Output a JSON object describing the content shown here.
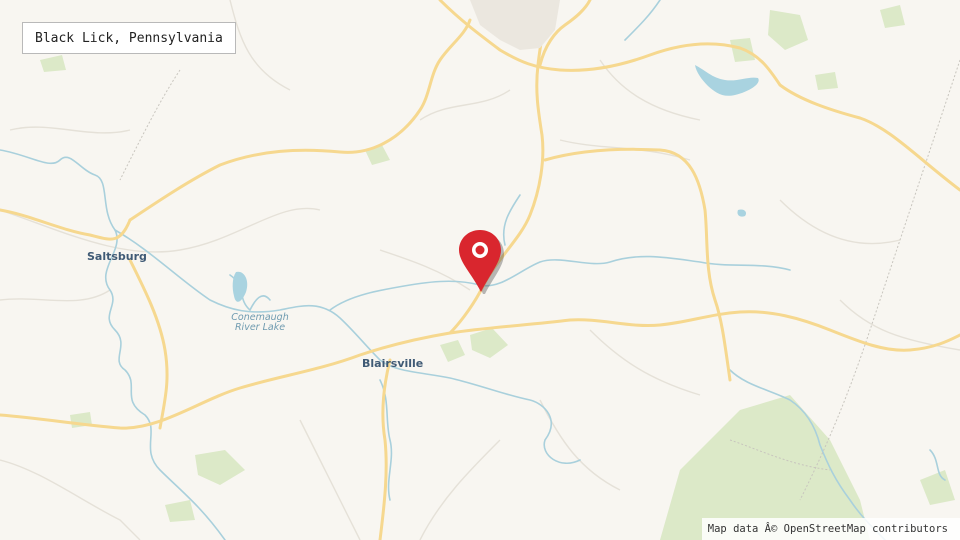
{
  "map": {
    "title": "Black Lick, Pennsylvania",
    "attribution": "Map data Â© OpenStreetMap contributors",
    "marker": {
      "place": "Black Lick, Pennsylvania",
      "color": "#d9262e",
      "icon": "map-pin-icon"
    },
    "labels": {
      "saltsburg": "Saltsburg",
      "blairsville": "Blairsville",
      "lake_line1": "Conemaugh",
      "lake_line2": "River Lake"
    },
    "colors": {
      "background": "#f8f6f1",
      "road": "#f6d88f",
      "minor_road": "#e3e0d9",
      "water": "#a9d3e0",
      "park": "#d8e8c4"
    }
  }
}
